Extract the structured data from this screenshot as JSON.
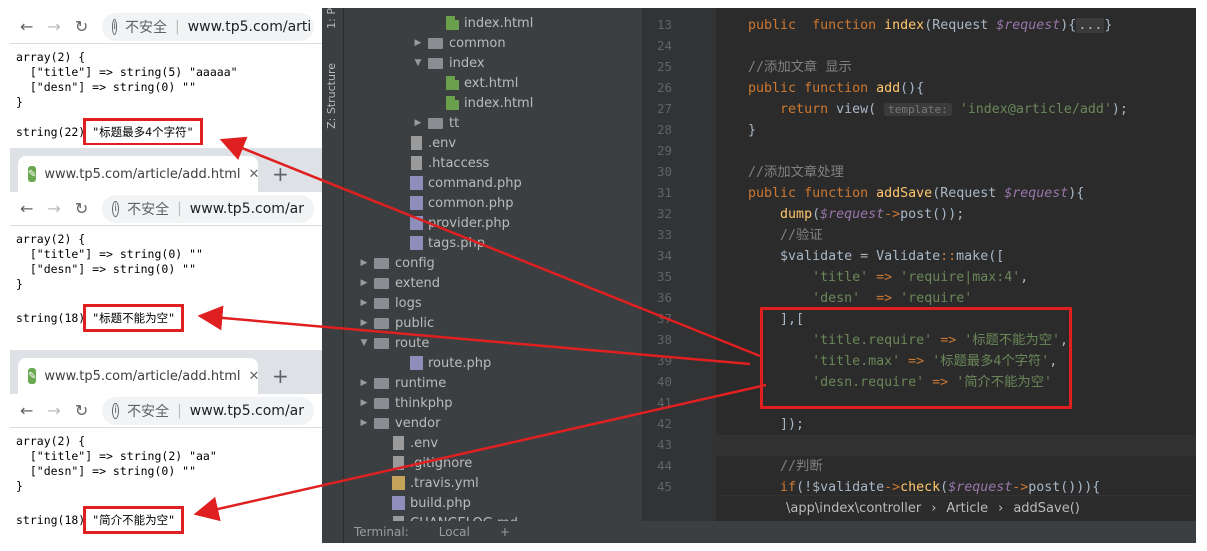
{
  "browsers": [
    {
      "url_host": "www.tp5.com/arti",
      "insecure": "不安全",
      "dump_lines": [
        "array(2) {",
        "  [\"title\"] => string(5) \"aaaaa\"",
        "  [\"desn\"] => string(0) \"\"",
        "}"
      ],
      "result_prefix": "string(22)",
      "result_msg": "\"标题最多4个字符\""
    },
    {
      "tab_title": "www.tp5.com/article/add.html",
      "url_host": "www.tp5.com/ar",
      "insecure": "不安全",
      "dump_lines": [
        "array(2) {",
        "  [\"title\"] => string(0) \"\"",
        "  [\"desn\"] => string(0) \"\"",
        "}"
      ],
      "result_prefix": "string(18)",
      "result_msg": "\"标题不能为空\""
    },
    {
      "tab_title": "www.tp5.com/article/add.html",
      "url_host": "www.tp5.com/ar",
      "insecure": "不安全",
      "dump_lines": [
        "array(2) {",
        "  [\"title\"] => string(2) \"aa\"",
        "  [\"desn\"] => string(0) \"\"",
        "}"
      ],
      "result_prefix": "string(18)",
      "result_msg": "\"简介不能为空\""
    }
  ],
  "ide": {
    "side_tabs": [
      "1: P",
      "Z: Structure"
    ],
    "tree": [
      {
        "label": "index.html",
        "indent": 5,
        "icon": "html"
      },
      {
        "label": "common",
        "indent": 4,
        "icon": "folder",
        "arrow": "▶"
      },
      {
        "label": "index",
        "indent": 4,
        "icon": "folder",
        "arrow": "▼"
      },
      {
        "label": "ext.html",
        "indent": 5,
        "icon": "html"
      },
      {
        "label": "index.html",
        "indent": 5,
        "icon": "html"
      },
      {
        "label": "tt",
        "indent": 4,
        "icon": "folder",
        "arrow": "▶"
      },
      {
        "label": ".env",
        "indent": 3,
        "icon": "txt"
      },
      {
        "label": ".htaccess",
        "indent": 3,
        "icon": "txt"
      },
      {
        "label": "command.php",
        "indent": 3,
        "icon": "php"
      },
      {
        "label": "common.php",
        "indent": 3,
        "icon": "php"
      },
      {
        "label": "provider.php",
        "indent": 3,
        "icon": "php"
      },
      {
        "label": "tags.php",
        "indent": 3,
        "icon": "php"
      },
      {
        "label": "config",
        "indent": 1,
        "icon": "folder",
        "arrow": "▶"
      },
      {
        "label": "extend",
        "indent": 1,
        "icon": "folder",
        "arrow": "▶"
      },
      {
        "label": "logs",
        "indent": 1,
        "icon": "folder",
        "arrow": "▶"
      },
      {
        "label": "public",
        "indent": 1,
        "icon": "folder",
        "arrow": "▶"
      },
      {
        "label": "route",
        "indent": 1,
        "icon": "folder",
        "arrow": "▼"
      },
      {
        "label": "route.php",
        "indent": 3,
        "icon": "php"
      },
      {
        "label": "runtime",
        "indent": 1,
        "icon": "folder",
        "arrow": "▶"
      },
      {
        "label": "thinkphp",
        "indent": 1,
        "icon": "folder",
        "arrow": "▶"
      },
      {
        "label": "vendor",
        "indent": 1,
        "icon": "folder",
        "arrow": "▶"
      },
      {
        "label": ".env",
        "indent": 2,
        "icon": "txt"
      },
      {
        "label": ".gitignore",
        "indent": 2,
        "icon": "txt"
      },
      {
        "label": ".travis.yml",
        "indent": 2,
        "icon": "yml"
      },
      {
        "label": "build.php",
        "indent": 2,
        "icon": "php"
      },
      {
        "label": "CHANGELOG.md",
        "indent": 2,
        "icon": "txt"
      }
    ],
    "line_numbers": [
      "13",
      "24",
      "25",
      "26",
      "27",
      "28",
      "29",
      "30",
      "31",
      "32",
      "33",
      "34",
      "35",
      "36",
      "37",
      "38",
      "39",
      "40",
      "41",
      "42",
      "43",
      "44",
      "45"
    ],
    "breadcrumb": [
      "\\app\\index\\controller",
      "Article",
      "addSave()"
    ],
    "status_items": [
      "Terminal:",
      "Local",
      "+"
    ]
  }
}
